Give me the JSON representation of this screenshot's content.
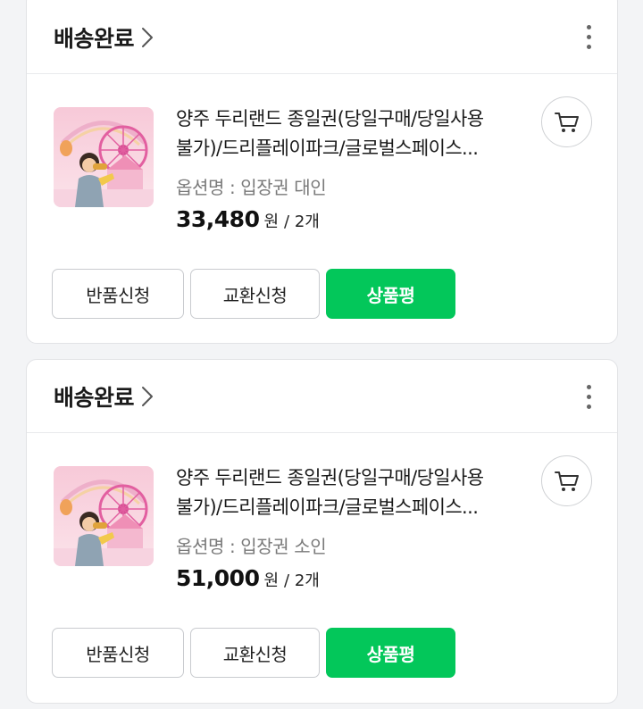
{
  "orders": [
    {
      "status": "배송완료",
      "product": {
        "name_line1": "양주 두리랜드 종일권(당일구매/당일사용",
        "name_line2": "불가)/드리플레이파크/글로벌스페이스...",
        "option": "옵션명 : 입장권 대인",
        "price": "33,480",
        "currency": "원",
        "quantity": "/ 2개"
      },
      "buttons": {
        "return": "반품신청",
        "exchange": "교환신청",
        "review": "상품평"
      }
    },
    {
      "status": "배송완료",
      "product": {
        "name_line1": "양주 두리랜드 종일권(당일구매/당일사용",
        "name_line2": "불가)/드리플레이파크/글로벌스페이스...",
        "option": "옵션명 : 입장권 소인",
        "price": "51,000",
        "currency": "원",
        "quantity": "/ 2개"
      },
      "buttons": {
        "return": "반품신청",
        "exchange": "교환신청",
        "review": "상품평"
      }
    }
  ],
  "icons": {
    "status_link": "chevron-right-icon",
    "menu": "kebab-menu-icon",
    "cart": "shopping-cart-icon"
  },
  "colors": {
    "accent_green": "#03c75a",
    "option_gray": "#7a7a7a",
    "card_border": "#e2e3e6"
  }
}
